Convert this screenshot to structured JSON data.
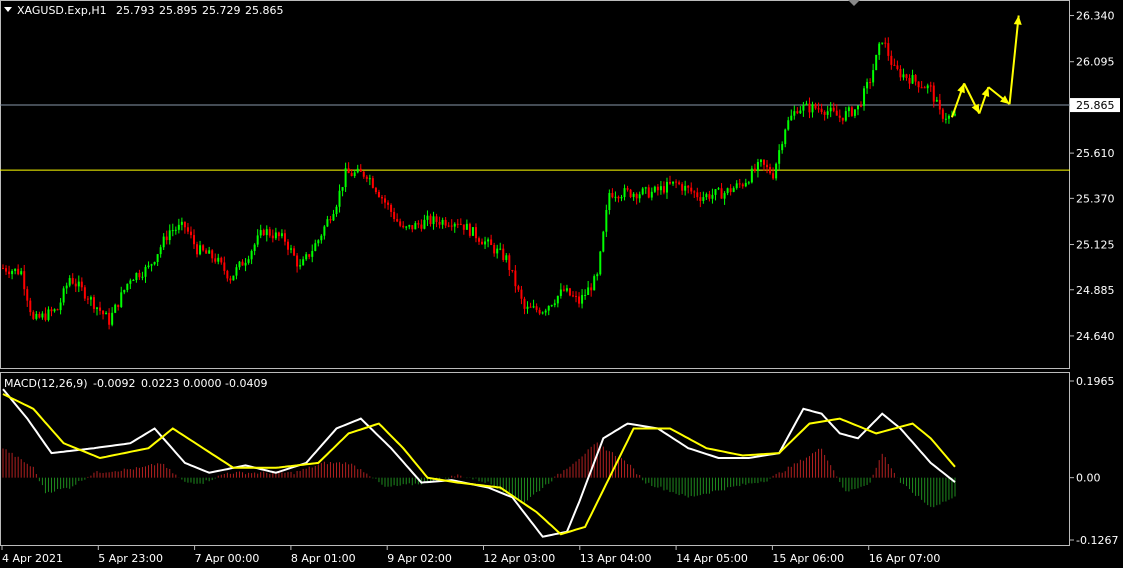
{
  "window": {
    "symbol_header": "XAGUSD.Exp,H1",
    "ohlc": [
      "25.793",
      "25.895",
      "25.729",
      "25.865"
    ]
  },
  "indicator": {
    "label": "MACD(12,26,9)",
    "values": [
      "-0.0092",
      "0.0223",
      "0.0000",
      "-0.0409"
    ]
  },
  "colors": {
    "background": "#000000",
    "bull": "#00ff00",
    "bear": "#ff0000",
    "level_line": "#ffff00",
    "current_price_line": "#8899aa",
    "macd_line": "#ffffff",
    "signal_line": "#ffff00",
    "hist_pos": "#b02020",
    "hist_neg": "#1e8a1e",
    "arrow": "#ffff00"
  },
  "chart_data": [
    {
      "type": "candlestick",
      "title": "",
      "ylim": [
        24.56,
        26.38
      ],
      "y_ticks": [
        "26.340",
        "26.095",
        "25.865",
        "25.610",
        "25.370",
        "25.125",
        "24.885",
        "24.640"
      ],
      "current_price": "25.865",
      "horizontal_level": 25.52,
      "x_labels": [
        "4 Apr 2021",
        "5 Apr 23:00",
        "7 Apr 00:00",
        "8 Apr 01:00",
        "9 Apr 02:00",
        "12 Apr 03:00",
        "13 Apr 04:00",
        "14 Apr 05:00",
        "15 Apr 06:00",
        "16 Apr 07:00"
      ],
      "price_path_keypoints": [
        [
          0,
          25.0
        ],
        [
          6,
          24.98
        ],
        [
          10,
          24.72
        ],
        [
          18,
          24.78
        ],
        [
          22,
          24.95
        ],
        [
          28,
          24.85
        ],
        [
          35,
          24.72
        ],
        [
          42,
          24.95
        ],
        [
          48,
          25.0
        ],
        [
          55,
          25.2
        ],
        [
          60,
          25.22
        ],
        [
          64,
          25.1
        ],
        [
          70,
          25.05
        ],
        [
          75,
          24.95
        ],
        [
          80,
          25.05
        ],
        [
          86,
          25.2
        ],
        [
          93,
          25.15
        ],
        [
          98,
          25.0
        ],
        [
          104,
          25.15
        ],
        [
          110,
          25.35
        ],
        [
          113,
          25.5
        ],
        [
          120,
          25.5
        ],
        [
          126,
          25.35
        ],
        [
          132,
          25.2
        ],
        [
          140,
          25.25
        ],
        [
          150,
          25.25
        ],
        [
          158,
          25.15
        ],
        [
          166,
          25.05
        ],
        [
          172,
          24.78
        ],
        [
          178,
          24.78
        ],
        [
          185,
          24.88
        ],
        [
          190,
          24.82
        ],
        [
          196,
          24.95
        ],
        [
          200,
          25.4
        ],
        [
          206,
          25.4
        ],
        [
          214,
          25.4
        ],
        [
          222,
          25.45
        ],
        [
          230,
          25.38
        ],
        [
          238,
          25.4
        ],
        [
          244,
          25.45
        ],
        [
          250,
          25.55
        ],
        [
          254,
          25.5
        ],
        [
          258,
          25.75
        ],
        [
          262,
          25.85
        ],
        [
          270,
          25.85
        ],
        [
          276,
          25.8
        ],
        [
          282,
          25.85
        ],
        [
          286,
          26.0
        ],
        [
          290,
          26.22
        ],
        [
          294,
          26.05
        ],
        [
          300,
          26.0
        ],
        [
          306,
          25.95
        ],
        [
          309,
          25.82
        ],
        [
          312,
          25.8
        ],
        [
          314,
          25.8
        ]
      ],
      "annotation_path": [
        [
          313,
          25.8
        ],
        [
          317,
          25.98
        ],
        [
          322,
          25.82
        ],
        [
          325,
          25.96
        ],
        [
          332,
          25.87
        ],
        [
          335,
          26.34
        ]
      ]
    },
    {
      "type": "line",
      "title": "MACD(12,26,9)",
      "ylim": [
        -0.1267,
        0.1965
      ],
      "y_ticks": [
        "0.1965",
        "0.00",
        "-0.1267"
      ],
      "series": [
        {
          "name": "MACD",
          "keypoints": [
            [
              0,
              0.18
            ],
            [
              8,
              0.12
            ],
            [
              16,
              0.05
            ],
            [
              30,
              0.06
            ],
            [
              42,
              0.07
            ],
            [
              50,
              0.1
            ],
            [
              60,
              0.03
            ],
            [
              68,
              0.01
            ],
            [
              80,
              0.025
            ],
            [
              90,
              0.01
            ],
            [
              100,
              0.03
            ],
            [
              110,
              0.1
            ],
            [
              118,
              0.12
            ],
            [
              128,
              0.06
            ],
            [
              138,
              -0.01
            ],
            [
              148,
              -0.005
            ],
            [
              160,
              -0.02
            ],
            [
              168,
              -0.04
            ],
            [
              178,
              -0.12
            ],
            [
              186,
              -0.11
            ],
            [
              190,
              -0.05
            ],
            [
              198,
              0.08
            ],
            [
              206,
              0.11
            ],
            [
              216,
              0.1
            ],
            [
              226,
              0.06
            ],
            [
              236,
              0.04
            ],
            [
              246,
              0.04
            ],
            [
              256,
              0.05
            ],
            [
              264,
              0.14
            ],
            [
              270,
              0.13
            ],
            [
              276,
              0.09
            ],
            [
              282,
              0.08
            ],
            [
              290,
              0.13
            ],
            [
              296,
              0.1
            ],
            [
              306,
              0.03
            ],
            [
              314,
              -0.009
            ]
          ]
        },
        {
          "name": "Signal",
          "keypoints": [
            [
              0,
              0.17
            ],
            [
              10,
              0.14
            ],
            [
              20,
              0.07
            ],
            [
              32,
              0.04
            ],
            [
              48,
              0.06
            ],
            [
              56,
              0.1
            ],
            [
              66,
              0.06
            ],
            [
              76,
              0.02
            ],
            [
              90,
              0.02
            ],
            [
              104,
              0.03
            ],
            [
              114,
              0.09
            ],
            [
              124,
              0.11
            ],
            [
              132,
              0.06
            ],
            [
              140,
              0.0
            ],
            [
              150,
              -0.01
            ],
            [
              164,
              -0.02
            ],
            [
              176,
              -0.07
            ],
            [
              184,
              -0.115
            ],
            [
              192,
              -0.1
            ],
            [
              200,
              0.0
            ],
            [
              208,
              0.1
            ],
            [
              220,
              0.1
            ],
            [
              232,
              0.06
            ],
            [
              244,
              0.045
            ],
            [
              256,
              0.05
            ],
            [
              266,
              0.11
            ],
            [
              276,
              0.12
            ],
            [
              288,
              0.09
            ],
            [
              300,
              0.11
            ],
            [
              306,
              0.08
            ],
            [
              314,
              0.022
            ]
          ]
        }
      ],
      "histogram_keypoints": [
        [
          0,
          0.06
        ],
        [
          10,
          0.02
        ],
        [
          14,
          -0.03
        ],
        [
          22,
          -0.02
        ],
        [
          30,
          0.01
        ],
        [
          46,
          0.02
        ],
        [
          52,
          0.03
        ],
        [
          60,
          -0.01
        ],
        [
          66,
          -0.01
        ],
        [
          74,
          0.01
        ],
        [
          96,
          0.01
        ],
        [
          106,
          0.03
        ],
        [
          114,
          0.03
        ],
        [
          120,
          0.01
        ],
        [
          126,
          -0.02
        ],
        [
          140,
          -0.01
        ],
        [
          150,
          0.005
        ],
        [
          160,
          -0.01
        ],
        [
          172,
          -0.05
        ],
        [
          180,
          -0.01
        ],
        [
          186,
          0.02
        ],
        [
          196,
          0.07
        ],
        [
          206,
          0.03
        ],
        [
          212,
          -0.01
        ],
        [
          226,
          -0.04
        ],
        [
          240,
          -0.02
        ],
        [
          252,
          -0.005
        ],
        [
          262,
          0.03
        ],
        [
          270,
          0.06
        ],
        [
          278,
          -0.03
        ],
        [
          286,
          -0.01
        ],
        [
          290,
          0.05
        ],
        [
          296,
          -0.01
        ],
        [
          306,
          -0.06
        ],
        [
          314,
          -0.04
        ]
      ]
    }
  ]
}
